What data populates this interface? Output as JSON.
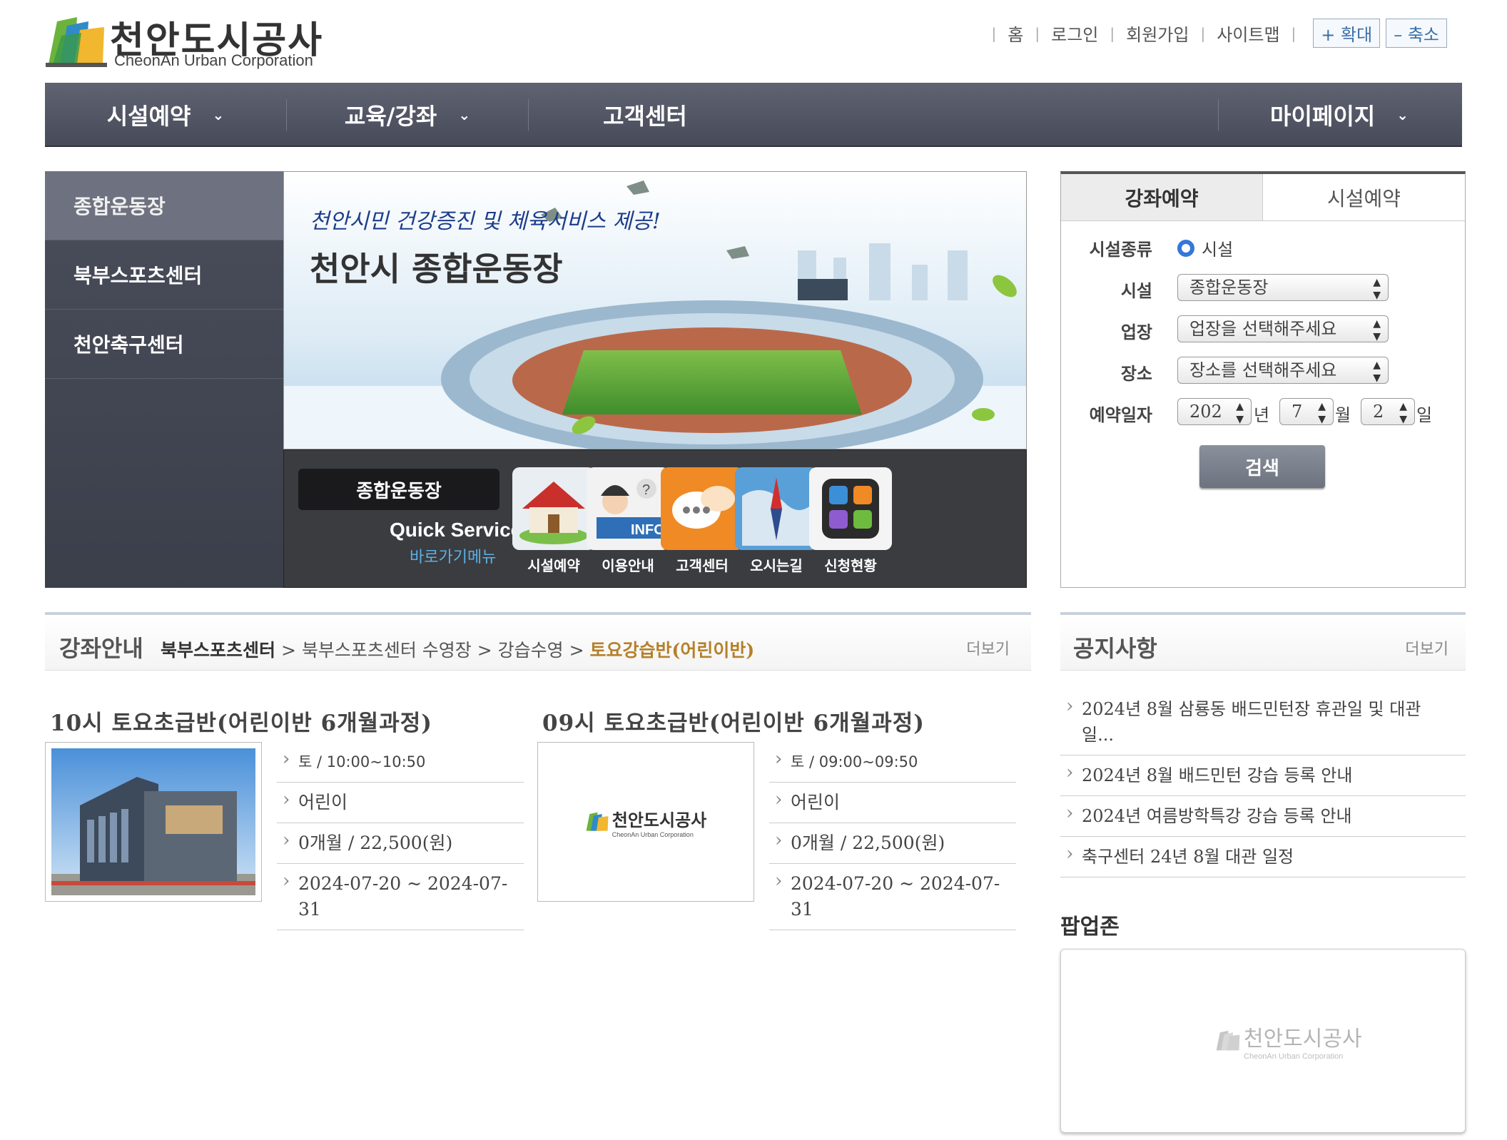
{
  "logo": {
    "name": "천안도시공사",
    "sub": "CheonAn Urban Corporation"
  },
  "util": {
    "home": "홈",
    "login": "로그인",
    "join": "회원가입",
    "sitemap": "사이트맵",
    "zoom_in": "+ 확대",
    "zoom_out": "– 축소"
  },
  "gnb": [
    {
      "label": "시설예약"
    },
    {
      "label": "교육/강좌"
    },
    {
      "label": "고객센터"
    },
    {
      "label": "마이페이지"
    }
  ],
  "lnb": [
    {
      "label": "종합운동장"
    },
    {
      "label": "북부스포츠센터"
    },
    {
      "label": "천안축구센터"
    }
  ],
  "visual": {
    "tagline": "천안시민 건강증진 및 체육서비스 제공!",
    "title": "천안시 종합운동장"
  },
  "quick": {
    "box": "종합운동장",
    "service": "Quick Service",
    "service_sub": "바로가기메뉴",
    "items": [
      {
        "label": "시설예약",
        "icon": "house-icon"
      },
      {
        "label": "이용안내",
        "icon": "info-desk-icon"
      },
      {
        "label": "고객센터",
        "icon": "chat-bubbles-icon"
      },
      {
        "label": "오시는길",
        "icon": "compass-map-icon"
      },
      {
        "label": "신청현황",
        "icon": "app-grid-icon"
      }
    ]
  },
  "reserve": {
    "tabs": [
      {
        "label": "강좌예약"
      },
      {
        "label": "시설예약"
      }
    ],
    "type_label": "시설종류",
    "type_option": "시설",
    "facility_label": "시설",
    "facility_value": "종합운동장",
    "venue_label": "업장",
    "venue_value": "업장을 선택해주세요",
    "place_label": "장소",
    "place_value": "장소를 선택해주세요",
    "date_label": "예약일자",
    "year": "202",
    "year_unit": "년",
    "month": "7",
    "month_unit": "월",
    "day": "2",
    "day_unit": "일",
    "search": "검색"
  },
  "course": {
    "title": "강좌안내",
    "breadcrumb": {
      "b1": "북부스포츠센터",
      "b2": "북부스포츠센터 수영장",
      "b3": "강습수영",
      "cur": "토요강습반(어린이반)",
      "sep": " > "
    },
    "more": "더보기",
    "items": [
      {
        "title": "10시 토요초급반(어린이반 6개월과정)",
        "day_time": "토 / 10:00~10:50",
        "target": "어린이",
        "price": "0개월 / 22,500(원)",
        "period": "2024-07-20 ~ 2024-07-31"
      },
      {
        "title": "09시 토요초급반(어린이반 6개월과정)",
        "day_time": "토 / 09:00~09:50",
        "target": "어린이",
        "price": "0개월 / 22,500(원)",
        "period": "2024-07-20 ~ 2024-07-31",
        "thumb_logo": "천안도시공사",
        "thumb_sub": "CheonAn Urban Corporation"
      }
    ]
  },
  "notice": {
    "title": "공지사항",
    "more": "더보기",
    "items": [
      "2024년 8월 삼룡동 배드민턴장 휴관일 및 대관일...",
      "2024년 8월 배드민턴 강습 등록 안내",
      "2024년 여름방학특강 강습 등록 안내",
      "축구센터 24년 8월 대관 일정"
    ]
  },
  "popup": {
    "title": "팝업존",
    "logo": "천안도시공사",
    "sub": "CheonAn Urban Corporation"
  },
  "colors": {
    "nav": "#4f5362",
    "accent_link": "#b5802a",
    "quick_sub": "#5ab0e6"
  }
}
